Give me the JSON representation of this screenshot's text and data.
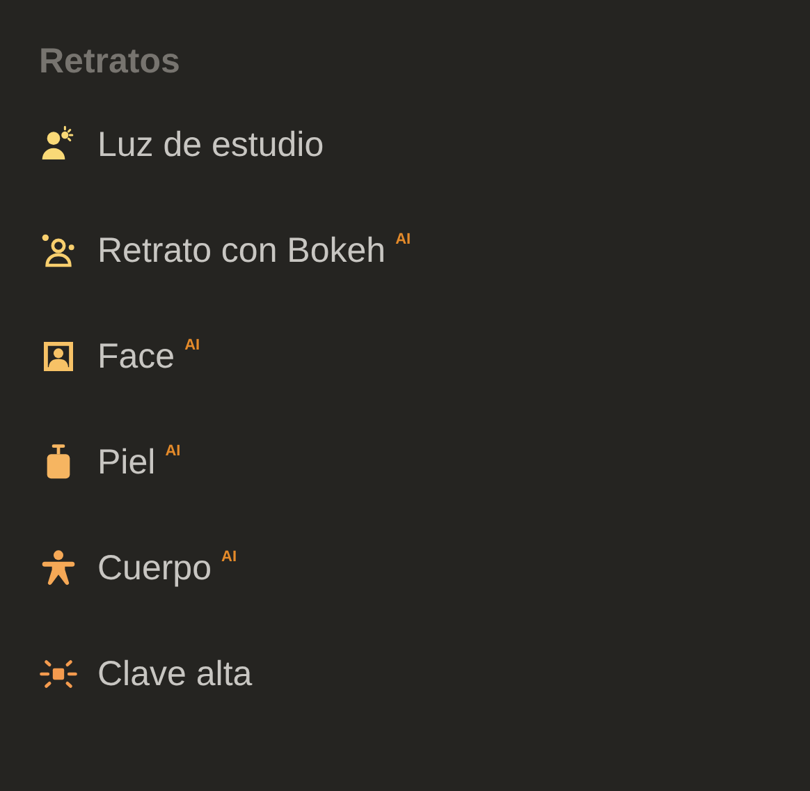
{
  "section": {
    "title": "Retratos"
  },
  "items": [
    {
      "kind": "studio-light",
      "label": "Luz de estudio",
      "color": "#f9d977"
    },
    {
      "kind": "bokeh",
      "label": "Retrato con Bokeh",
      "badge": "AI",
      "color": "#f8cf6e"
    },
    {
      "kind": "portrait",
      "label": "Face",
      "badge": "AI",
      "color": "#f7c266"
    },
    {
      "kind": "skin",
      "label": "Piel",
      "badge": "AI",
      "color": "#f6b561"
    },
    {
      "kind": "body",
      "label": "Cuerpo",
      "badge": "AI",
      "color": "#f5a856"
    },
    {
      "kind": "high-key",
      "label": "Clave alta",
      "color": "#f49b4e"
    }
  ]
}
